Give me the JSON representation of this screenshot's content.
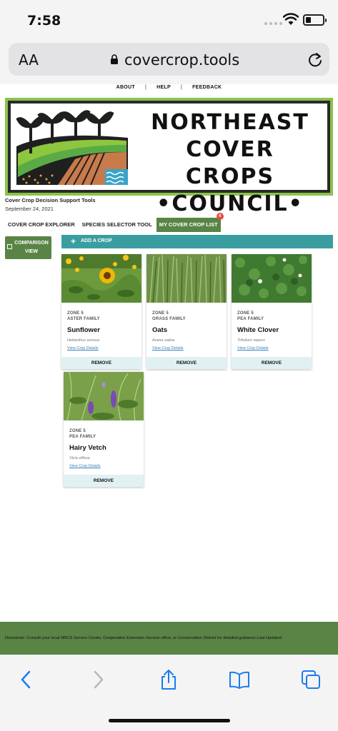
{
  "status_bar": {
    "time": "7:58"
  },
  "browser": {
    "aa_label": "AA",
    "url": "covercrop.tools"
  },
  "top_nav": {
    "items": [
      "ABOUT",
      "HELP",
      "FEEDBACK"
    ]
  },
  "banner": {
    "line1": "NORTHEAST",
    "line2": "COVER CROPS",
    "line3": "•COUNCIL•"
  },
  "site": {
    "subtitle": "Cover Crop Decision Support Tools",
    "date": "September 24, 2021"
  },
  "tabs": [
    {
      "label": "COVER CROP EXPLORER"
    },
    {
      "label": "SPECIES SELECTOR TOOL"
    },
    {
      "label": "MY COVER CROP LIST",
      "badge": "4"
    }
  ],
  "comparison_button": {
    "label": "COMPARISON VIEW"
  },
  "add_crop": {
    "label": "ADD A CROP"
  },
  "crops": [
    {
      "zone": "ZONE 5",
      "family": "ASTER FAMILY",
      "name": "Sunflower",
      "scientific": "Helianthus annuus",
      "link": "View Crop Details",
      "remove": "REMOVE"
    },
    {
      "zone": "ZONE 5",
      "family": "GRASS FAMILY",
      "name": "Oats",
      "scientific": "Avena sativa",
      "link": "View Crop Details",
      "remove": "REMOVE"
    },
    {
      "zone": "ZONE 5",
      "family": "PEA FAMILY",
      "name": "White Clover",
      "scientific": "Trifolium repens",
      "link": "View Crop Details",
      "remove": "REMOVE"
    },
    {
      "zone": "ZONE 5",
      "family": "PEA FAMILY",
      "name": "Hairy Vetch",
      "scientific": "Vicia villosa",
      "link": "View Crop Details",
      "remove": "REMOVE"
    }
  ],
  "footer": {
    "disclaimer": "Disclaimer: Consult your local NRCS Service Center, Cooperative Extension Service office, or Conservation District for detailed guidance.Last Updated"
  },
  "colors": {
    "primary_green": "#598445",
    "teal": "#3a9ea0",
    "banner_green": "#8bc34a",
    "ios_blue": "#1a7cf0"
  },
  "toolbar_icons": [
    "back-icon",
    "forward-icon",
    "share-icon",
    "bookmarks-icon",
    "tabs-icon"
  ]
}
